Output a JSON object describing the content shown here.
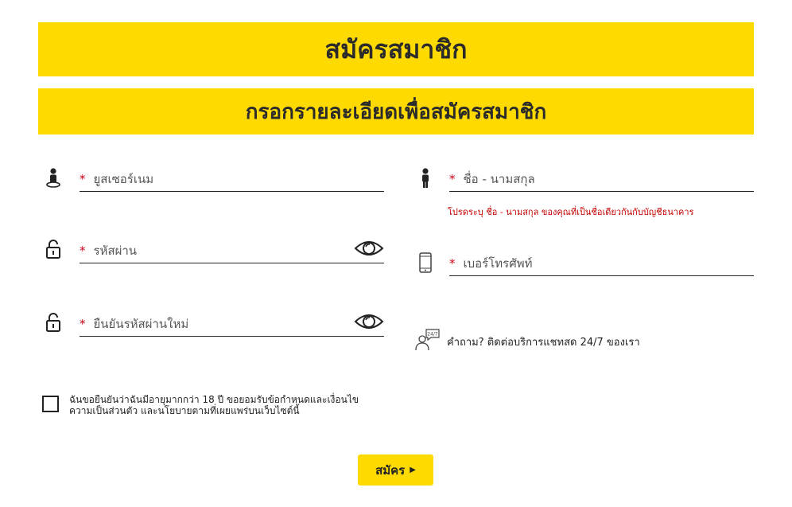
{
  "header": {
    "title": "สมัครสมาชิก",
    "subtitle": "กรอกรายละเอียดเพื่อสมัครสมาชิก"
  },
  "form": {
    "required_mark": "*",
    "username_placeholder": "ยูสเซอร์เนม",
    "password_placeholder": "รหัสผ่าน",
    "confirm_password_placeholder": "ยืนยันรหัสผ่านใหม่",
    "fullname_placeholder": "ชื่อ - นามสกุล",
    "fullname_hint": "โปรดระบุ ชื่อ - นามสกุล ของคุณที่เป็นชื่อเดียวกันกับบัญชีธนาคาร",
    "phone_placeholder": "เบอร์โทรศัพท์"
  },
  "support": {
    "text": "คำถาม? ติดต่อบริการแชทสด 24/7 ของเรา",
    "icon_badge": "24/7"
  },
  "agreement": {
    "text": "ฉันขอยืนยันว่าฉันมีอายุมากกว่า 18 ปี ขอยอมรับข้อกำหนดและเงื่อนไขความเป็นส่วนตัว และนโยบายตามที่เผยแพร่บนเว็บไซต์นี้",
    "checked": false
  },
  "submit": {
    "label": "สมัคร",
    "arrow": "▶"
  },
  "colors": {
    "accent": "#ffda00",
    "required": "#d0021b",
    "hint": "#c40000"
  }
}
